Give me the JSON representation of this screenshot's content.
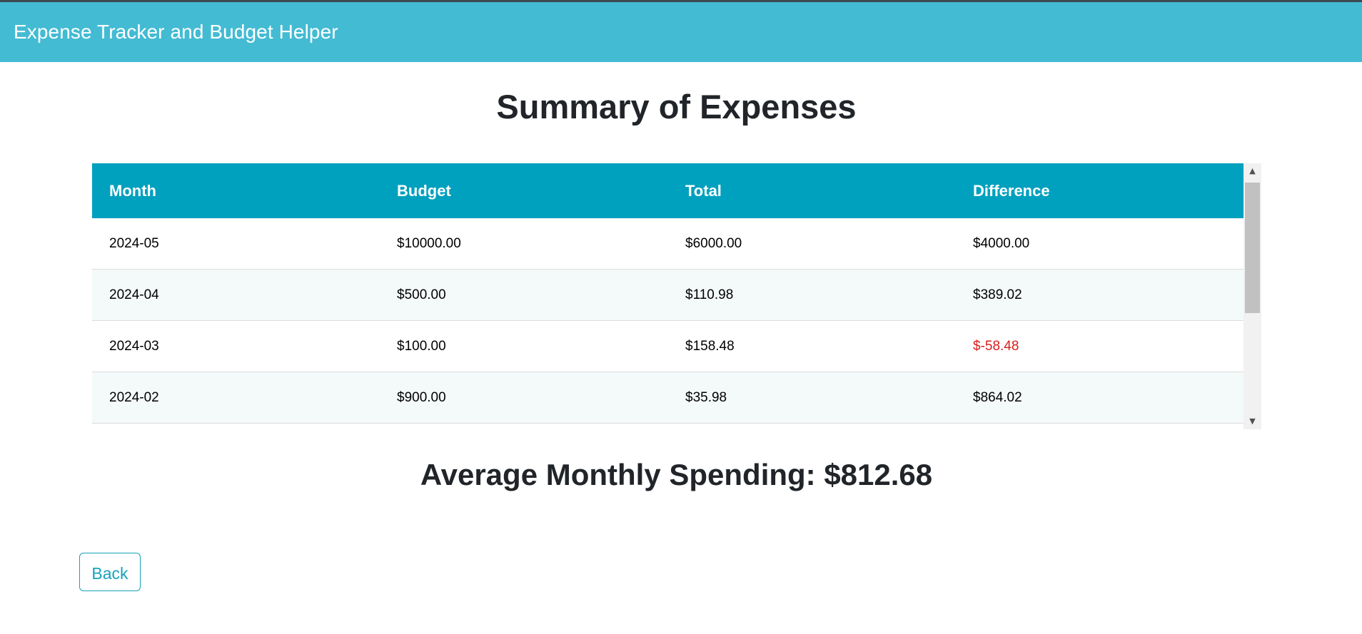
{
  "app": {
    "title": "Expense Tracker and Budget Helper"
  },
  "page": {
    "title": "Summary of Expenses"
  },
  "table": {
    "headers": [
      "Month",
      "Budget",
      "Total",
      "Difference"
    ],
    "rows": [
      {
        "month": "2024-05",
        "budget": "$10000.00",
        "total": "$6000.00",
        "difference": "$4000.00"
      },
      {
        "month": "2024-04",
        "budget": "$500.00",
        "total": "$110.98",
        "difference": "$389.02"
      },
      {
        "month": "2024-03",
        "budget": "$100.00",
        "total": "$158.48",
        "difference": "$-58.48"
      },
      {
        "month": "2024-02",
        "budget": "$900.00",
        "total": "$35.98",
        "difference": "$864.02"
      }
    ]
  },
  "scrollbar": {
    "up_icon": "scroll-up-arrow-icon",
    "down_icon": "scroll-down-arrow-icon"
  },
  "summary": {
    "average_text": "Average Monthly Spending: $812.68"
  },
  "actions": {
    "back_label": "Back"
  },
  "colors": {
    "navbar": "#43bbd3",
    "table_header": "#00a0bf",
    "negative": "#d91e1e",
    "button": "#17a2b8"
  }
}
